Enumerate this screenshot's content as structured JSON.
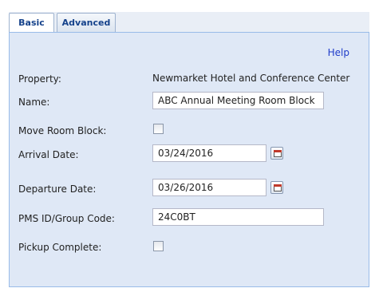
{
  "tabs": [
    {
      "label": "Basic",
      "active": true
    },
    {
      "label": "Advanced",
      "active": false
    }
  ],
  "help_link": "Help",
  "form": {
    "property": {
      "label": "Property:",
      "value": "Newmarket Hotel and Conference Center"
    },
    "name": {
      "label": "Name:",
      "value": "ABC Annual Meeting Room Block"
    },
    "move_room_block": {
      "label": "Move Room Block:",
      "checked": false
    },
    "arrival_date": {
      "label": "Arrival Date:",
      "value": "03/24/2016"
    },
    "departure_date": {
      "label": "Departure Date:",
      "value": "03/26/2016"
    },
    "pms_id": {
      "label": "PMS ID/Group Code:",
      "value": "24C0BT"
    },
    "pickup_complete": {
      "label": "Pickup Complete:",
      "checked": false
    }
  },
  "colors": {
    "panel_bg": "#dfe8f6",
    "tab_text": "#15428b",
    "link": "#1f3bc9"
  },
  "icons": {
    "calendar": "calendar-icon"
  }
}
